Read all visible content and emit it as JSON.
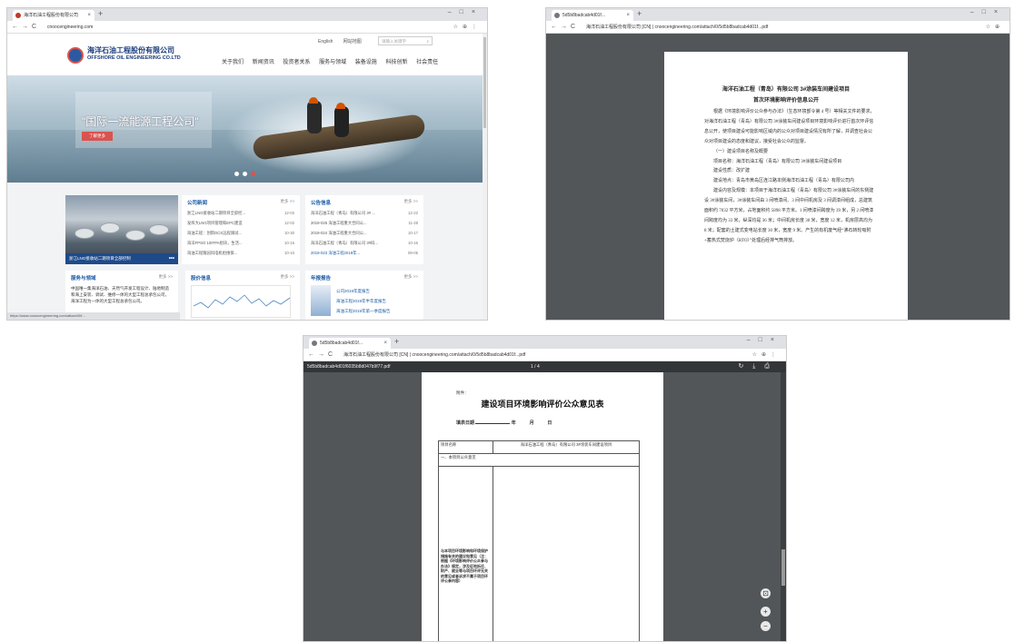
{
  "win1": {
    "tab_title": "海洋石油工程股份有限公司",
    "url": "cnoocengineering.com",
    "company_cn": "海洋石油工程股份有限公司",
    "company_en": "OFFSHORE OIL ENGINEERING CO.LTD",
    "top_links": [
      "English",
      "网站地图"
    ],
    "search_placeholder": "请输入关键字",
    "nav": [
      "关于我们",
      "新闻资讯",
      "投资者关系",
      "服务与领域",
      "装备设施",
      "科技创新",
      "社会责任"
    ],
    "slogan": "\"国际一流能源工程公司\"",
    "banner_btn": "了解更多",
    "photo_caption": "浙江LNG接收站二期项目全部控制",
    "news": {
      "title": "公司新闻",
      "more": "更多 >>",
      "items": [
        {
          "t": "浙江LNG接收站二期项目全部控...",
          "d": "12-02"
        },
        {
          "t": "发挥大LNG项目管理和EPC建造",
          "d": "12-02"
        },
        {
          "t": "海油工程：创新DCS远程调试...",
          "d": "10-30"
        },
        {
          "t": "海洋FPSO 10IFPA组块，生活...",
          "d": "10-15"
        },
        {
          "t": "海油工程陵园风电机组维保...",
          "d": "10-10"
        }
      ]
    },
    "notice": {
      "title": "公告信息",
      "more": "更多 >>",
      "items": [
        {
          "t": "海洋石油工程（青岛）有限公司 3# ...",
          "d": "12-22"
        },
        {
          "t": "2019-025 海油工程重大合同公...",
          "d": "11-28"
        },
        {
          "t": "2019-024 海油工程重大合同公...",
          "d": "10-17"
        },
        {
          "t": "海洋石油工程（青岛）有限公司 3#码...",
          "d": "10-16"
        },
        {
          "t": "2019-023 海油工程2019年...",
          "d": "09-05"
        }
      ]
    },
    "service": {
      "title": "服务与领域",
      "more": "更多 >>",
      "text": "中国唯一集海洋石油、天然气开发工程设计、陆地制造和海上安装、调试、维修一体的大型工程总承包公司，海洋工程为一体的大型工程总承包公司。"
    },
    "stock": {
      "title": "股价信息",
      "more": "更多 >>"
    },
    "report": {
      "title": "年报报告",
      "more": "更多 >>",
      "items": [
        "公司2019年度报告",
        "海油工程2019年半年度报告",
        "海油工程2019年第一季度报告"
      ]
    },
    "status_url": "https://www.cnoocengineering.com/attach/0/f..."
  },
  "win2": {
    "tab_title": "5d5b8badcab4d01f...",
    "url": "海洋石油工程股份有限公司 [CN] | cnoocengineering.com/attach/0/5d5b8badcab4d01f...pdf",
    "title1": "海洋石油工程（青岛）有限公司 3#涂装车间建设项目",
    "title2": "首次环境影响评价信息公开",
    "paras": [
      "根据《环境影响评价公众参与办法》（生态环境部令第 4 号）等相关文件的要求，对海洋石油工程（青岛）有限公司 3#涂装车间建设项目环境影响评价进行首次环评信息公开，使项目建设可能影响区域内的公众对项目建设情况有所了解，并调查社会公众对项目建设的态度和建议，接受社会公众的监督。",
      "（一）建设项目名称及概要",
      "项目名称：海洋石油工程（青岛）有限公司 3#涂装车间建设项目",
      "建设性质：改扩建",
      "建设地点：青岛市黄岛区连江路本侧海洋石油工程（青岛）有限公司内",
      "建设内容及规模：本项目于海洋石油工程（青岛）有限公司 3#涂装车间的东侧建设 3#涂装车间，3#涂装车间由 3 间喷漆间、3 间中间机房及 3 间调漆间组成，总建筑面积约 7032 平方米，占地面积约 5898 平方米。1 间喷漆间跨度为 39 米，另 2 间喷漆间跨度均为 33 米，纵深均是 36 米；中间机房长度 30 米，宽度 12 米，机房层高均为 8 米；配套的土建式变电站长度 30 米，宽度 9 米。产生的有机废气经“沸石转轮吸附+蓄热式焚烧炉（RTO）”处理后经排气筒排放。"
    ]
  },
  "win3": {
    "tab_title": "5d5b8badcab4d01f...",
    "url": "海洋石油工程股份有限公司 [CN] | cnoocengineering.com/attach/0/5d5b8badcab4d01f...pdf",
    "pdf_name": "5d5b8badcab4d01f6035b8d047b9f77.pdf",
    "page": "1 / 4",
    "annex": "附件：",
    "form_title": "建设项目环境影响评价公众意见表",
    "fill_date": "填表日期",
    "year": "年",
    "month": "月",
    "day": "日",
    "project_label": "项目名称",
    "project_value": "海洋石油工程（青岛）有限公司 3#涂装车间建设项目",
    "section1": "一、本项目公众意见",
    "opinion_label": "与本项目环境影响和环境保护措施有关的建议和意见（注：根据《环境影响评价公众参与办法》规定，涉及征地拆迁、财产、就业等与项目环评无关的意见或者诉求不属于项目环评公参内容）"
  }
}
